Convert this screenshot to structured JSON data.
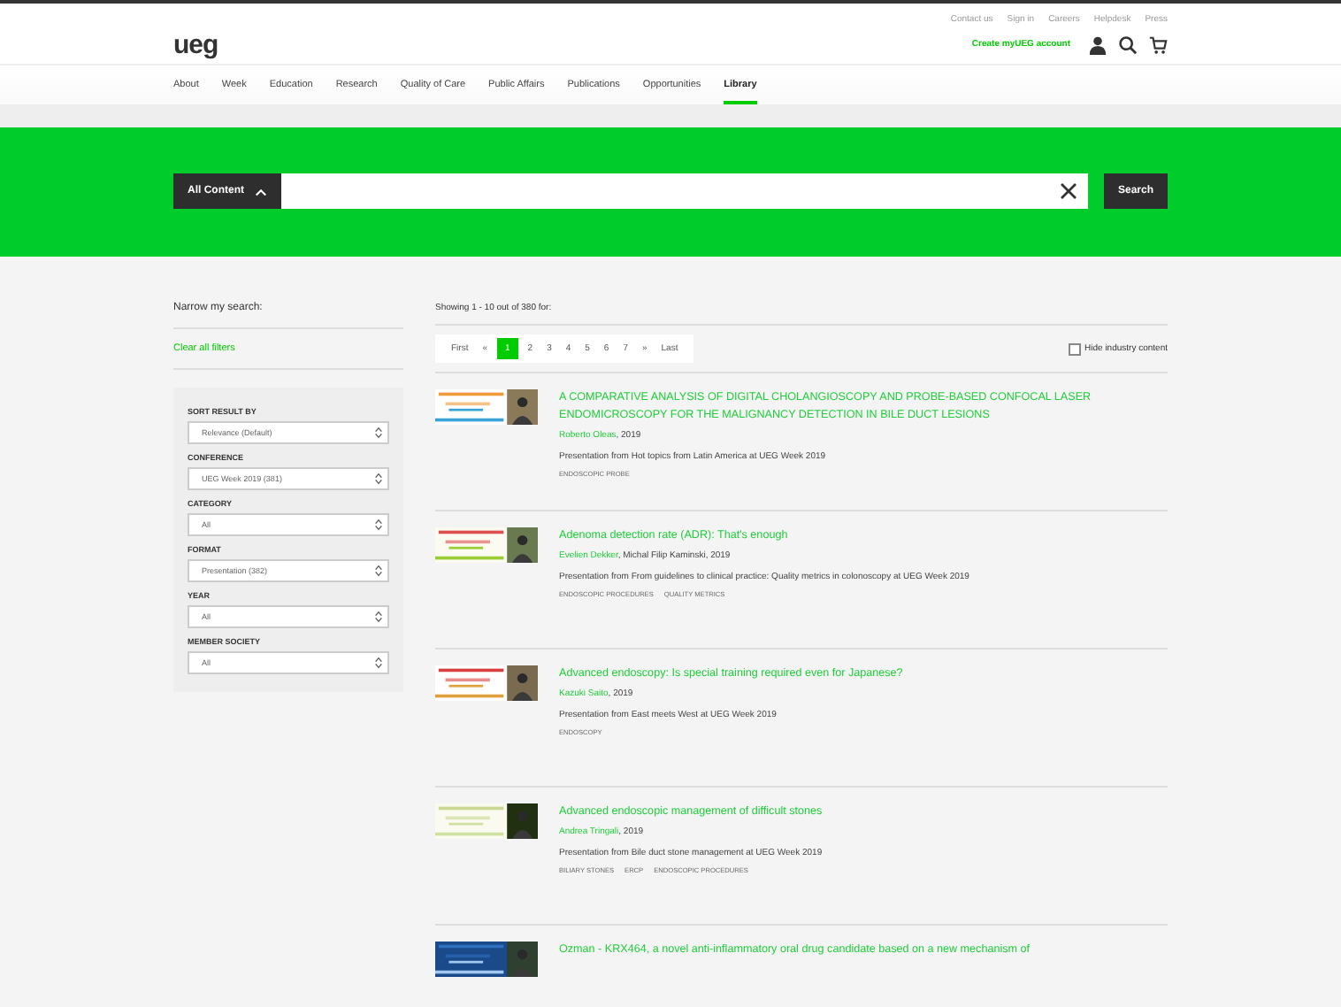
{
  "utility_links": [
    "Contact us",
    "Sign in",
    "Careers",
    "Helpdesk",
    "Press"
  ],
  "logo": "ueg",
  "account_link": "Create myUEG account",
  "nav": [
    {
      "label": "About",
      "selected": false
    },
    {
      "label": "Week",
      "selected": false
    },
    {
      "label": "Education",
      "selected": false
    },
    {
      "label": "Research",
      "selected": false
    },
    {
      "label": "Quality of Care",
      "selected": false
    },
    {
      "label": "Public Affairs",
      "selected": false
    },
    {
      "label": "Publications",
      "selected": false
    },
    {
      "label": "Opportunities",
      "selected": false
    },
    {
      "label": "Library",
      "selected": true
    }
  ],
  "search": {
    "scope": "All Content",
    "button": "Search"
  },
  "sidebar": {
    "title": "Narrow my search:",
    "clear": "Clear all filters",
    "filters": [
      {
        "label": "SORT RESULT BY",
        "value": "Relevance (Default)"
      },
      {
        "label": "CONFERENCE",
        "value": "UEG Week 2019 (381)"
      },
      {
        "label": "CATEGORY",
        "value": "All"
      },
      {
        "label": "FORMAT",
        "value": "Presentation (382)"
      },
      {
        "label": "YEAR",
        "value": "All"
      },
      {
        "label": "MEMBER SOCIETY",
        "value": "All"
      }
    ]
  },
  "results_summary": "Showing 1 - 10 out of 380 for:",
  "pagination": [
    {
      "label": "First",
      "selected": false
    },
    {
      "label": "«",
      "selected": false
    },
    {
      "label": "1",
      "selected": true
    },
    {
      "label": "2",
      "selected": false
    },
    {
      "label": "3",
      "selected": false
    },
    {
      "label": "4",
      "selected": false
    },
    {
      "label": "5",
      "selected": false
    },
    {
      "label": "6",
      "selected": false
    },
    {
      "label": "7",
      "selected": false
    },
    {
      "label": "»",
      "selected": false
    },
    {
      "label": "Last",
      "selected": false
    }
  ],
  "hide_industry": {
    "label": "Hide industry content",
    "checked": false
  },
  "results": [
    {
      "title": "A COMPARATIVE ANALYSIS OF DIGITAL CHOLANGIOSCOPY AND PROBE-BASED CONFOCAL LASER ENDOMICROSCOPY FOR THE MALIGNANCY DETECTION IN BILE DUCT LESIONS",
      "author": "Roberto Oleas",
      "rest": ", 2019",
      "source": "Presentation from Hot topics from Latin America at UEG Week 2019",
      "tags": [
        "ENDOSCOPIC PROBE"
      ]
    },
    {
      "title": "Adenoma detection rate (ADR): That's enough",
      "author": "Evelien Dekker",
      "rest": ", Michal Filip Kaminski, 2019",
      "source": "Presentation from From guidelines to clinical practice: Quality metrics in colonoscopy at UEG Week 2019",
      "tags": [
        "ENDOSCOPIC PROCEDURES",
        "QUALITY METRICS"
      ]
    },
    {
      "title": "Advanced endoscopy: Is special training required even for Japanese?",
      "author": "Kazuki Saito",
      "rest": ", 2019",
      "source": "Presentation from East meets West at UEG Week 2019",
      "tags": [
        "ENDOSCOPY"
      ]
    },
    {
      "title": "Advanced endoscopic management of difficult stones",
      "author": "Andrea Tringali",
      "rest": ", 2019",
      "source": "Presentation from Bile duct stone management at UEG Week 2019",
      "tags": [
        "BILIARY STONES",
        "ERCP",
        "ENDOSCOPIC PROCEDURES"
      ]
    },
    {
      "title": "Ozman - KRX464, a novel anti-inflammatory oral drug candidate based on a new mechanism of"
    }
  ]
}
